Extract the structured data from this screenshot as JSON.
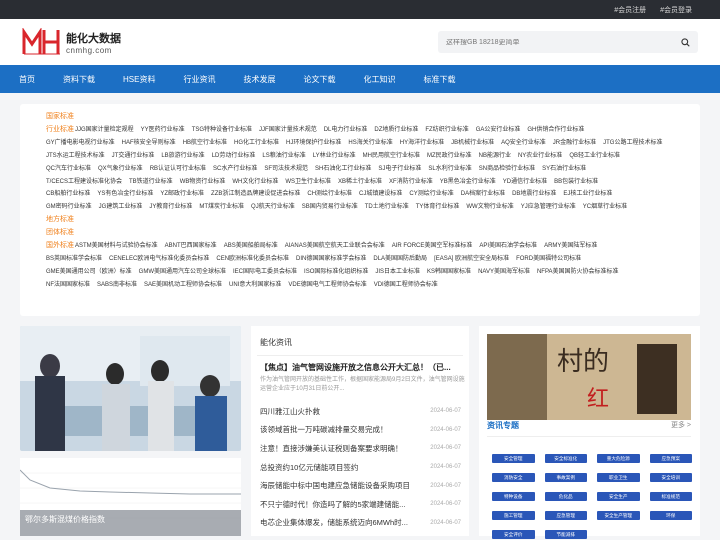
{
  "topbar": {
    "register": "#会员注册",
    "login": "#会员登录"
  },
  "logo": {
    "cn": "能化大数据",
    "en": "cnmhg.com"
  },
  "search": {
    "placeholder": "这样搜GB 18218更简单"
  },
  "nav": [
    "首页",
    "资料下载",
    "HSE资料",
    "行业资讯",
    "技术发展",
    "论文下载",
    "化工知识",
    "标准下载"
  ],
  "standards": [
    {
      "label": "国家标准",
      "items": []
    },
    {
      "label": "行业标准",
      "items": [
        "JJG国家计量检定规程",
        "YY医药行业标准",
        "TSG特种设备行业标准",
        "JJF国家计量技术规范",
        "DL电力行业标准",
        "DZ地质行业标准",
        "FZ纺织行业标准",
        "GA公安行业标准",
        "GH供销合作行业标准"
      ]
    },
    {
      "label": "",
      "items": [
        "GY广播电影电视行业标准",
        "HAF核安全导则标准",
        "HB航空行业标准",
        "HG化工行业标准",
        "HJ环境保护行业标准",
        "HS海关行业标准",
        "HY海洋行业标准",
        "JB机械行业标准",
        "AQ安全行业标准",
        "JR金融行业标准",
        "JTG公路工程技术标准"
      ]
    },
    {
      "label": "",
      "items": [
        "JTS水运工程技术标准",
        "JT交通行业标准",
        "LB旅游行业标准",
        "LD劳动行业标准",
        "LS粮油行业标准",
        "LY林业行业标准",
        "MH民用航空行业标准",
        "MZ民政行业标准",
        "NB能源行业",
        "NY农业行业标准",
        "QB轻工业行业标准"
      ]
    },
    {
      "label": "",
      "items": [
        "QC汽车行业标准",
        "QX气象行业标准",
        "RB认证认可行业标准",
        "SC水产行业标准",
        "SF司法技术规范",
        "SH石油化工行业标准",
        "SJ电子行业标准",
        "SL水利行业标准",
        "SN商品检验行业标准",
        "SY石油行业标准"
      ]
    },
    {
      "label": "",
      "items": [
        "T/CECS工程建设标准化协会",
        "TB铁道行业标准",
        "WB物资行业标准",
        "WH文化行业标准",
        "WS卫生行业标准",
        "XB稀土行业标准",
        "XF消防行业标准",
        "YB黑色冶金行业标准",
        "YD通信行业标准",
        "BB包装行业标准"
      ]
    },
    {
      "label": "",
      "items": [
        "CB船舶行业标准",
        "YS有色冶金行业标准",
        "YZ邮政行业标准",
        "ZZB浙江制造品牌建设促进会标准",
        "CH测绘行业标准",
        "CJ城镇建设标准",
        "CY测绘行业标准",
        "DA档案行业标准",
        "DB地震行业标准",
        "EJ核工业行业标准"
      ]
    },
    {
      "label": "",
      "items": [
        "GM密码行业标准",
        "JG建筑工业标准",
        "JY教育行业标准",
        "MT煤炭行业标准",
        "QJ航天行业标准",
        "SB国内贸易行业标准",
        "TD土地行业标准",
        "TY体育行业标准",
        "WW文物行业标准",
        "YJ应急管理行业标准",
        "YC烟草行业标准"
      ]
    },
    {
      "label": "地方标准",
      "items": []
    },
    {
      "label": "团体标准",
      "items": []
    },
    {
      "label": "国外标准",
      "items": [
        "ASTM美国材料与试验协会标准",
        "ABNT巴西国家标准",
        "ABS美国船舶局标准",
        "AIANAS美国航空航天工业联合会标准",
        "AIR FORCE美国空军标准标准",
        "API美国石油学会标准",
        "ARMY美国陆军标准"
      ]
    },
    {
      "label": "",
      "items": [
        "BS英国标准学会标准",
        "CENELEC欧洲电气标准化委员会标准",
        "CEN欧洲标准化委员会标准",
        "DIN德国国家标准学会标准",
        "DLA美国国防后勤局",
        "[EASA] 欧洲航空安全局标准",
        "FORD美国福特公司标准"
      ]
    },
    {
      "label": "",
      "items": [
        "GME美国通用公司（欧洲）标准",
        "GMW美国通用汽车公司全球标准",
        "IEC国际电工委员会标准",
        "ISO国际标准化组织标准",
        "JIS日本工业标准",
        "KS韩国国家标准",
        "NAVY美国海军标准",
        "NFPA美国国防火协会标准标准"
      ]
    },
    {
      "label": "",
      "items": [
        "NF法国国家标准",
        "SABS南非标准",
        "SAE美国机动工程师协会标准",
        "UNI意大利国家标准",
        "VDE德国电气工程师协会标准",
        "VDI德国工程师协会标准"
      ]
    }
  ],
  "photo": {
    "caption": ""
  },
  "chart": {
    "caption": "鄂尔多斯混煤价格指数"
  },
  "news": {
    "title": "能化资讯",
    "feature_title": "【焦点】油气管网设施开放之信息公开大汇总！（已...",
    "feature_desc": "作为油气管网开放的基础性工作，根据国家能源局9月2日文件，油气管网设施运营企业应于10月31日前公开...",
    "items": [
      {
        "t": "四川雅江山火扑救",
        "d": "2024-06-07"
      },
      {
        "t": "该领域首批一万吨碳减排量交易完成！",
        "d": "2024-06-07"
      },
      {
        "t": "注意！直接涉嫌美认证税则备案要求明确！",
        "d": "2024-06-07"
      },
      {
        "t": "总投资约10亿元储能项目签约",
        "d": "2024-06-07"
      },
      {
        "t": "海辰储能中标中国电建应急储能设备采购项目",
        "d": "2024-06-07"
      },
      {
        "t": "不只宁德时代！你造吗了解的5家端建储能...",
        "d": "2024-06-07"
      },
      {
        "t": "电芯企业集体爆发，储能系统迈向6MWh时...",
        "d": "2024-06-07"
      }
    ]
  },
  "topics": {
    "title": "资讯专题",
    "more": "更多 >",
    "tiles": [
      "安全管理",
      "安全标准化",
      "重大危险源",
      "应急预案",
      "消防安全",
      "事故案例",
      "职业卫生",
      "安全培训",
      "特种设备",
      "危化品",
      "安全生产",
      "标准规范",
      "施工管理",
      "应急管理",
      "安全生产管理",
      "环保",
      "安全评价",
      "节能减排"
    ]
  },
  "colors": {
    "nav": "#1c6fc4",
    "accent": "#f0821e",
    "logo_red": "#d9262c",
    "tile": "#2a56b8"
  }
}
